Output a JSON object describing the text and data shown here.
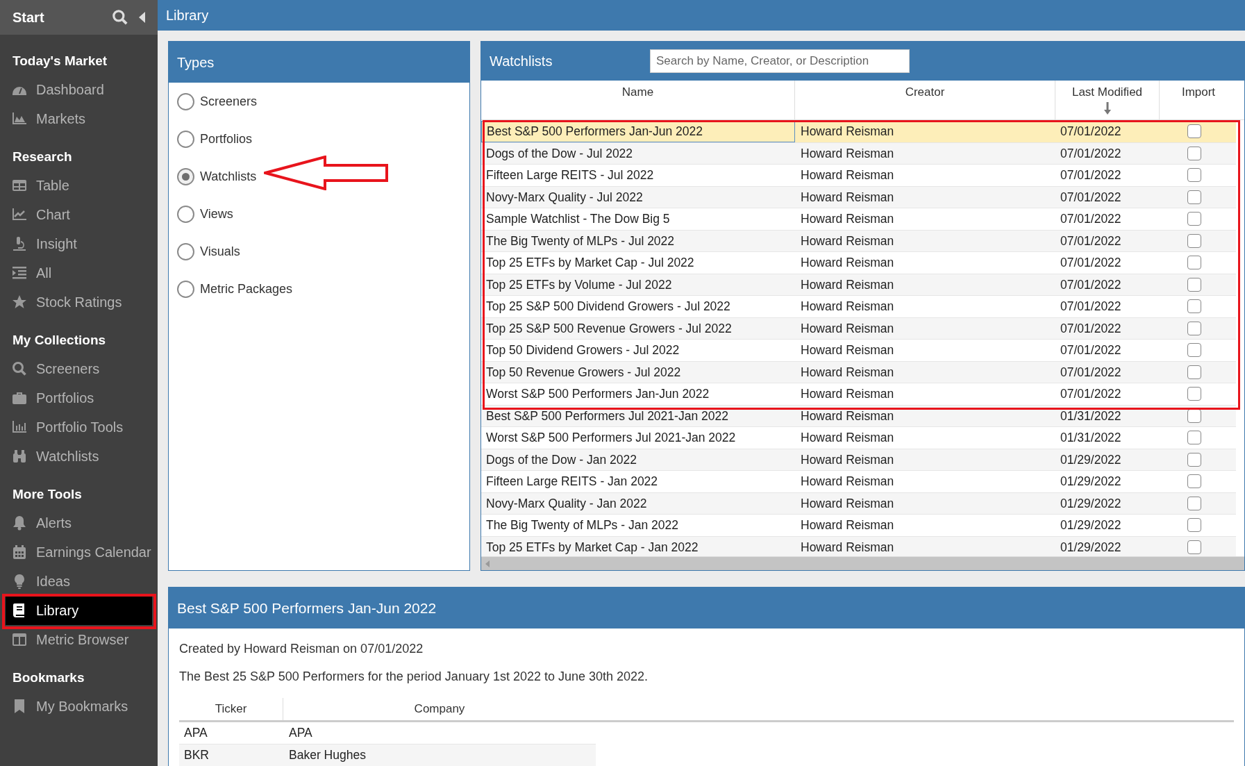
{
  "sidebar": {
    "title": "Start",
    "sections": [
      {
        "heading": "Today's Market",
        "items": [
          {
            "label": "Dashboard",
            "selected": false
          },
          {
            "label": "Markets",
            "selected": false
          }
        ]
      },
      {
        "heading": "Research",
        "items": [
          {
            "label": "Table",
            "selected": false
          },
          {
            "label": "Chart",
            "selected": false
          },
          {
            "label": "Insight",
            "selected": false
          },
          {
            "label": "All",
            "selected": false
          },
          {
            "label": "Stock Ratings",
            "selected": false
          }
        ]
      },
      {
        "heading": "My Collections",
        "items": [
          {
            "label": "Screeners",
            "selected": false
          },
          {
            "label": "Portfolios",
            "selected": false
          },
          {
            "label": "Portfolio Tools",
            "selected": false
          },
          {
            "label": "Watchlists",
            "selected": false
          }
        ]
      },
      {
        "heading": "More Tools",
        "items": [
          {
            "label": "Alerts",
            "selected": false
          },
          {
            "label": "Earnings Calendar",
            "selected": false
          },
          {
            "label": "Ideas",
            "selected": false
          },
          {
            "label": "Library",
            "selected": true
          },
          {
            "label": "Metric Browser",
            "selected": false
          }
        ]
      },
      {
        "heading": "Bookmarks",
        "items": [
          {
            "label": "My Bookmarks",
            "selected": false
          }
        ]
      }
    ]
  },
  "page_title": "Library",
  "types": {
    "title": "Types",
    "options": [
      {
        "label": "Screeners",
        "selected": false
      },
      {
        "label": "Portfolios",
        "selected": false
      },
      {
        "label": "Watchlists",
        "selected": true
      },
      {
        "label": "Views",
        "selected": false
      },
      {
        "label": "Visuals",
        "selected": false
      },
      {
        "label": "Metric Packages",
        "selected": false
      }
    ]
  },
  "watchlists": {
    "title": "Watchlists",
    "search": {
      "placeholder": "Search by Name, Creator, or Description"
    },
    "columns": [
      {
        "label": "Name",
        "sorted": false
      },
      {
        "label": "Creator",
        "sorted": false
      },
      {
        "label": "Last Modified",
        "sorted": true
      },
      {
        "label": "Import",
        "sorted": false
      }
    ],
    "rows": [
      {
        "name": "Best S&P 500 Performers Jan-Jun 2022",
        "creator": "Howard Reisman",
        "modified": "07/01/2022",
        "checked": false,
        "selected": true
      },
      {
        "name": "Dogs of the Dow - Jul 2022",
        "creator": "Howard Reisman",
        "modified": "07/01/2022",
        "checked": false,
        "selected": false
      },
      {
        "name": "Fifteen Large REITS - Jul 2022",
        "creator": "Howard Reisman",
        "modified": "07/01/2022",
        "checked": false,
        "selected": false
      },
      {
        "name": "Novy-Marx Quality - Jul 2022",
        "creator": "Howard Reisman",
        "modified": "07/01/2022",
        "checked": false,
        "selected": false
      },
      {
        "name": "Sample Watchlist - The Dow Big 5",
        "creator": "Howard Reisman",
        "modified": "07/01/2022",
        "checked": false,
        "selected": false
      },
      {
        "name": "The Big Twenty of MLPs - Jul 2022",
        "creator": "Howard Reisman",
        "modified": "07/01/2022",
        "checked": false,
        "selected": false
      },
      {
        "name": "Top 25 ETFs by Market Cap - Jul 2022",
        "creator": "Howard Reisman",
        "modified": "07/01/2022",
        "checked": false,
        "selected": false
      },
      {
        "name": "Top 25 ETFs by Volume - Jul 2022",
        "creator": "Howard Reisman",
        "modified": "07/01/2022",
        "checked": false,
        "selected": false
      },
      {
        "name": "Top 25 S&P 500 Dividend Growers - Jul 2022",
        "creator": "Howard Reisman",
        "modified": "07/01/2022",
        "checked": false,
        "selected": false
      },
      {
        "name": "Top 25 S&P 500 Revenue Growers - Jul 2022",
        "creator": "Howard Reisman",
        "modified": "07/01/2022",
        "checked": false,
        "selected": false
      },
      {
        "name": "Top 50 Dividend Growers - Jul 2022",
        "creator": "Howard Reisman",
        "modified": "07/01/2022",
        "checked": false,
        "selected": false
      },
      {
        "name": "Top 50 Revenue Growers - Jul 2022",
        "creator": "Howard Reisman",
        "modified": "07/01/2022",
        "checked": false,
        "selected": false
      },
      {
        "name": "Worst S&P 500 Performers Jan-Jun 2022",
        "creator": "Howard Reisman",
        "modified": "07/01/2022",
        "checked": false,
        "selected": false
      },
      {
        "name": "Best S&P 500 Performers Jul 2021-Jan 2022",
        "creator": "Howard Reisman",
        "modified": "01/31/2022",
        "checked": false,
        "selected": false
      },
      {
        "name": "Worst S&P 500 Performers Jul 2021-Jan 2022",
        "creator": "Howard Reisman",
        "modified": "01/31/2022",
        "checked": false,
        "selected": false
      },
      {
        "name": "Dogs of the Dow - Jan 2022",
        "creator": "Howard Reisman",
        "modified": "01/29/2022",
        "checked": false,
        "selected": false
      },
      {
        "name": "Fifteen Large REITS - Jan 2022",
        "creator": "Howard Reisman",
        "modified": "01/29/2022",
        "checked": false,
        "selected": false
      },
      {
        "name": "Novy-Marx Quality - Jan 2022",
        "creator": "Howard Reisman",
        "modified": "01/29/2022",
        "checked": false,
        "selected": false
      },
      {
        "name": "The Big Twenty of MLPs - Jan 2022",
        "creator": "Howard Reisman",
        "modified": "01/29/2022",
        "checked": false,
        "selected": false
      },
      {
        "name": "Top 25 ETFs by Market Cap - Jan 2022",
        "creator": "Howard Reisman",
        "modified": "01/29/2022",
        "checked": false,
        "selected": false
      }
    ]
  },
  "detail": {
    "title": "Best S&P 500 Performers Jan-Jun 2022",
    "created": "Created by Howard Reisman on 07/01/2022",
    "description": "The Best 25 S&P 500 Performers for the period January 1st 2022 to June 30th 2022.",
    "columns": [
      "Ticker",
      "Company"
    ],
    "rows": [
      {
        "ticker": "APA",
        "company": "APA"
      },
      {
        "ticker": "BKR",
        "company": "Baker Hughes"
      }
    ]
  }
}
